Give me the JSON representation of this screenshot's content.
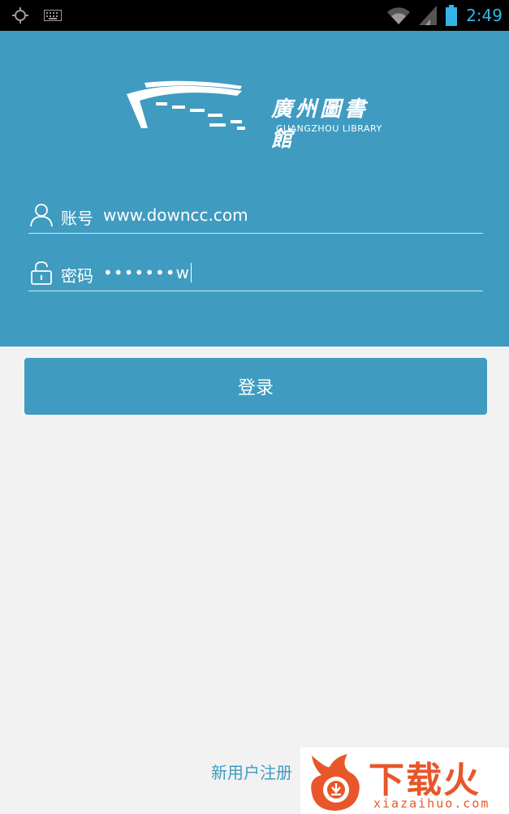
{
  "status_bar": {
    "time": "2:49",
    "icons": [
      "gps-icon",
      "keyboard-icon",
      "wifi-icon",
      "signal-icon",
      "battery-icon"
    ],
    "accent": "#33b5e5"
  },
  "header": {
    "logo_cn": "廣州圖書館",
    "logo_en": "GUANGZHOU LIBRARY",
    "bg_color": "#409bc0"
  },
  "form": {
    "account": {
      "label": "账号",
      "value": "www.downcc.com",
      "icon": "user-icon"
    },
    "password": {
      "label": "密码",
      "value": "•••••••w",
      "icon": "lock-icon"
    },
    "login_label": "登录"
  },
  "footer": {
    "register_label": "新用户注册"
  },
  "watermark": {
    "title": "下载火",
    "subtitle": "xiazaihuo.com"
  }
}
